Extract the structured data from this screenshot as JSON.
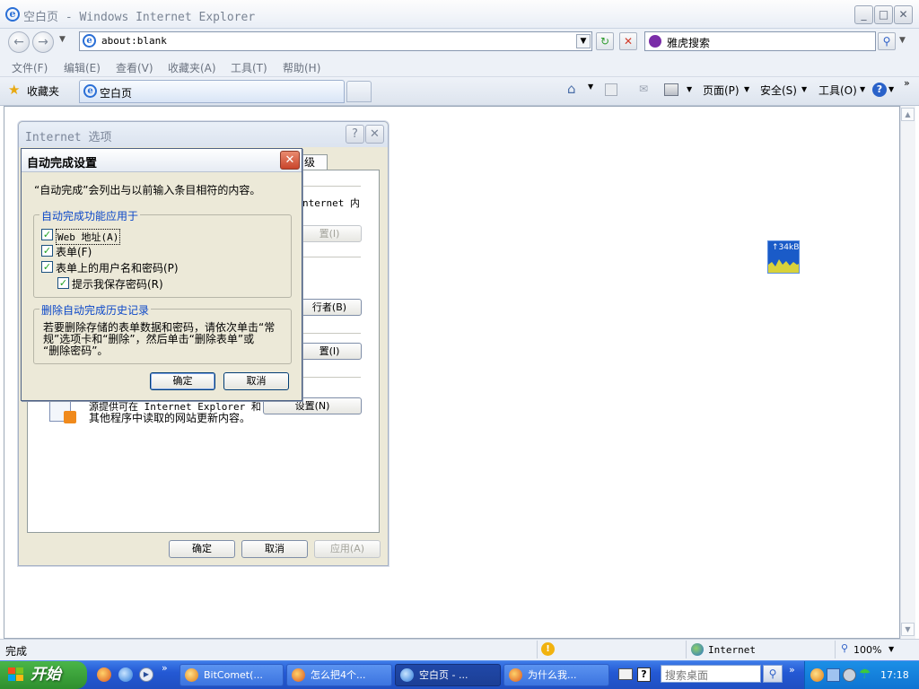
{
  "window": {
    "title": "空白页 - Windows Internet Explorer"
  },
  "address": {
    "url": "about:blank"
  },
  "search": {
    "value": "雅虎搜索"
  },
  "menu": [
    "文件(F)",
    "编辑(E)",
    "查看(V)",
    "收藏夹(A)",
    "工具(T)",
    "帮助(H)"
  ],
  "favorites": {
    "label": "收藏夹"
  },
  "tab": {
    "title": "空白页"
  },
  "toolbar": {
    "page": "页面(P)",
    "safety": "安全(S)",
    "tools": "工具(O)"
  },
  "widget": {
    "text": "↑34kB"
  },
  "status": {
    "text": "完成",
    "zone": "Internet",
    "zoom": "100%"
  },
  "taskbar": {
    "start": "开始",
    "tasks": [
      "BitComet(...",
      "怎么把4个...",
      "空白页 - ...",
      "为什么我..."
    ],
    "desktop_search": "搜索桌面",
    "clock": "17:18"
  },
  "options_dialog": {
    "title": "Internet 选项",
    "tab_partial": "级",
    "text1": "nternet 内",
    "btn_settings_t": "置(I)",
    "btn_publisher": "行者(B)",
    "btn_settings_i": "置(I)",
    "feed_text_1": "源提供可在 Internet Explorer 和",
    "feed_text_2": "其他程序中读取的网站更新内容。",
    "btn_feed_settings": "设置(N)",
    "ok": "确定",
    "cancel": "取消",
    "apply": "应用(A)"
  },
  "autocomplete": {
    "title": "自动完成设置",
    "intro": "“自动完成”会列出与以前输入条目相符的内容。",
    "group1_label": "自动完成功能应用于",
    "opt_web": "Web 地址(A)",
    "opt_forms": "表单(F)",
    "opt_passwords": "表单上的用户名和密码(P)",
    "opt_prompt": "提示我保存密码(R)",
    "group2_label": "删除自动完成历史记录",
    "delete_text_1": "若要删除存储的表单数据和密码，请依次单击“常",
    "delete_text_2": "规”选项卡和“删除”，然后单击“删除表单”或",
    "delete_text_3": "“删除密码”。",
    "ok": "确定",
    "cancel": "取消"
  }
}
